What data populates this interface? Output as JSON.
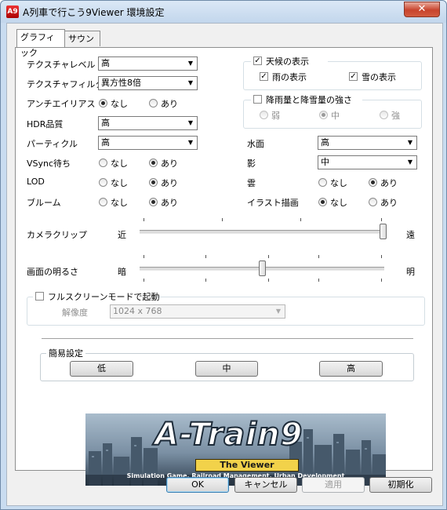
{
  "window": {
    "title": "A列車で行こう9Viewer 環境設定",
    "app_icon": "A9",
    "close_glyph": "✕"
  },
  "tabs": [
    {
      "label": "グラフィック",
      "active": true
    },
    {
      "label": "サウンド",
      "active": false
    }
  ],
  "graphics": {
    "texture_level": {
      "label": "テクスチャレベル",
      "value": "高"
    },
    "texture_filter": {
      "label": "テクスチャフィルター",
      "value": "異方性8倍"
    },
    "antialias": {
      "label": "アンチエイリアス",
      "opt_off": "なし",
      "opt_on": "あり",
      "selected": "なし"
    },
    "hdr": {
      "label": "HDR品質",
      "value": "高"
    },
    "particle": {
      "label": "パーティクル",
      "value": "高"
    },
    "vsync": {
      "label": "VSync待ち",
      "opt_off": "なし",
      "opt_on": "あり",
      "selected": "あり"
    },
    "lod": {
      "label": "LOD",
      "opt_off": "なし",
      "opt_on": "あり",
      "selected": "あり"
    },
    "bloom": {
      "label": "ブルーム",
      "opt_off": "なし",
      "opt_on": "あり",
      "selected": "あり"
    },
    "weather": {
      "label": "天候の表示",
      "checked": true,
      "rain": {
        "label": "雨の表示",
        "checked": true
      },
      "snow": {
        "label": "雪の表示",
        "checked": true
      }
    },
    "precip": {
      "label": "降雨量と降雪量の強さ",
      "checked": false,
      "weak": "弱",
      "medium": "中",
      "strong": "強",
      "selected": "中"
    },
    "water": {
      "label": "水面",
      "value": "高"
    },
    "shadow": {
      "label": "影",
      "value": "中"
    },
    "cloud": {
      "label": "雲",
      "opt_off": "なし",
      "opt_on": "あり",
      "selected": "あり"
    },
    "illust": {
      "label": "イラスト描画",
      "opt_off": "なし",
      "opt_on": "あり",
      "selected": "なし"
    },
    "camera_clip": {
      "label": "カメラクリップ",
      "min_label": "近",
      "max_label": "遠",
      "level": 1.0
    },
    "brightness": {
      "label": "画面の明るさ",
      "min_label": "暗",
      "max_label": "明",
      "level": 0.5
    },
    "fullscreen": {
      "label": "フルスクリーンモードで起動",
      "checked": false,
      "resolution_label": "解像度",
      "resolution_value": "1024 x 768"
    },
    "presets": {
      "label": "簡易設定",
      "low": "低",
      "mid": "中",
      "high": "高"
    }
  },
  "banner": {
    "logo": "A-Train9",
    "subtitle": "The Viewer",
    "tagline": "Simulation Game, Railroad Management, Urban Development"
  },
  "footer": {
    "ok": "OK",
    "cancel": "キャンセル",
    "apply": "適用",
    "reset": "初期化"
  }
}
